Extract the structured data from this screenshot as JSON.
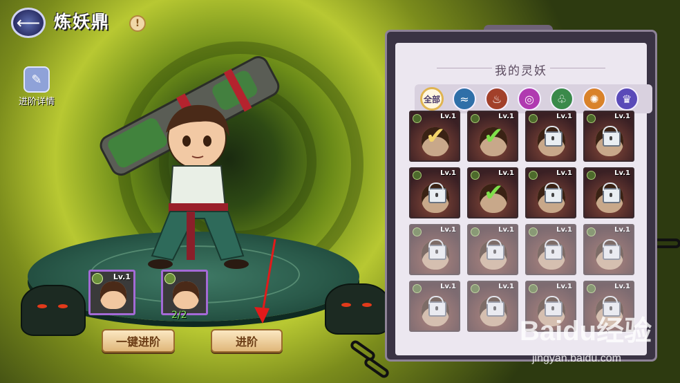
{
  "header": {
    "title": "炼妖鼎",
    "back_icon": "back-arrow-icon",
    "info_icon": "!"
  },
  "side": {
    "detail_label": "进阶详情"
  },
  "materials": [
    {
      "level": "Lv.1"
    },
    {
      "level": ""
    }
  ],
  "material_count": "2/2",
  "buttons": {
    "one_key": "一键进阶",
    "advance": "进阶"
  },
  "panel": {
    "title": "我的灵妖",
    "filters": [
      {
        "label": "全部",
        "color": "#fff7e0",
        "active": true
      },
      {
        "label": "≈",
        "color": "#2f6fa8",
        "active": false
      },
      {
        "label": "♨",
        "color": "#a2402a",
        "active": false
      },
      {
        "label": "◎",
        "color": "#b03ab0",
        "active": false
      },
      {
        "label": "♧",
        "color": "#3a8a4a",
        "active": false
      },
      {
        "label": "✺",
        "color": "#d9822a",
        "active": false
      },
      {
        "label": "♛",
        "color": "#5a4ab8",
        "active": false
      }
    ],
    "cards": [
      {
        "level": "Lv.1",
        "state": "check-gold",
        "dim": false
      },
      {
        "level": "Lv.1",
        "state": "check-green",
        "dim": false
      },
      {
        "level": "Lv.1",
        "state": "lock",
        "dim": false
      },
      {
        "level": "Lv.1",
        "state": "lock",
        "dim": false
      },
      {
        "level": "Lv.1",
        "state": "lock",
        "dim": false
      },
      {
        "level": "Lv.1",
        "state": "check-green",
        "dim": false
      },
      {
        "level": "Lv.1",
        "state": "lock",
        "dim": false
      },
      {
        "level": "Lv.1",
        "state": "lock",
        "dim": false
      },
      {
        "level": "Lv.1",
        "state": "lock",
        "dim": true
      },
      {
        "level": "Lv.1",
        "state": "lock",
        "dim": true
      },
      {
        "level": "Lv.1",
        "state": "lock",
        "dim": true
      },
      {
        "level": "Lv.1",
        "state": "lock",
        "dim": true
      },
      {
        "level": "Lv.1",
        "state": "lock",
        "dim": true
      },
      {
        "level": "Lv.1",
        "state": "lock",
        "dim": true
      },
      {
        "level": "Lv.1",
        "state": "lock",
        "dim": true
      },
      {
        "level": "Lv.1",
        "state": "lock",
        "dim": true
      }
    ]
  },
  "watermark": {
    "logo": "Baidu经验",
    "url": "jingyan.baidu.com"
  },
  "colors": {
    "check_gold": "#f3d36a",
    "check_green": "#7fe04a",
    "material_border": "#a46ad6"
  }
}
